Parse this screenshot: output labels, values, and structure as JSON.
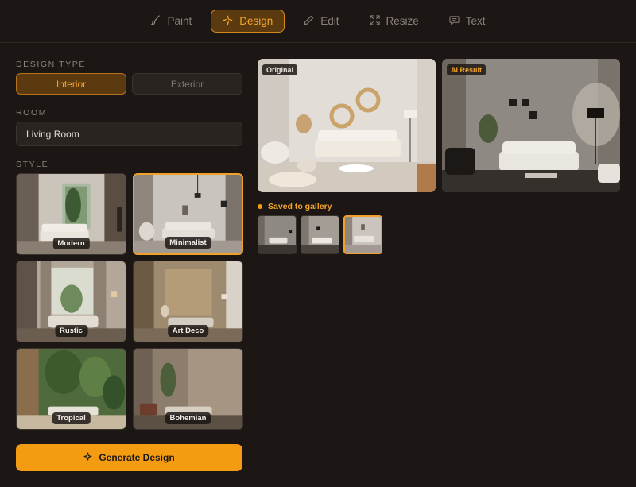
{
  "toolbar": {
    "tabs": [
      {
        "label": "Paint",
        "icon": "brush-icon"
      },
      {
        "label": "Design",
        "icon": "sparkle-icon",
        "active": true
      },
      {
        "label": "Edit",
        "icon": "pencil-icon"
      },
      {
        "label": "Resize",
        "icon": "resize-icon"
      },
      {
        "label": "Text",
        "icon": "chat-bubble-icon"
      }
    ]
  },
  "design_type": {
    "label": "DESIGN TYPE",
    "options": [
      "Interior",
      "Exterior"
    ],
    "selected": "Interior"
  },
  "room": {
    "label": "ROOM",
    "value": "Living Room"
  },
  "style": {
    "label": "STYLE",
    "options": [
      "Modern",
      "Minimalist",
      "Rustic",
      "Art Deco",
      "Tropical",
      "Bohemian"
    ],
    "selected": "Minimalist"
  },
  "generate": {
    "label": "Generate Design",
    "icon": "sparkle-icon"
  },
  "preview": {
    "original_tag": "Original",
    "result_tag": "AI Result"
  },
  "gallery": {
    "status": "Saved to gallery",
    "thumbnail_count": 3,
    "active_index": 2
  },
  "colors": {
    "accent": "#f39c12",
    "accent_text": "#f3a52a",
    "background": "#1c1714",
    "panel": "#2a2420"
  }
}
